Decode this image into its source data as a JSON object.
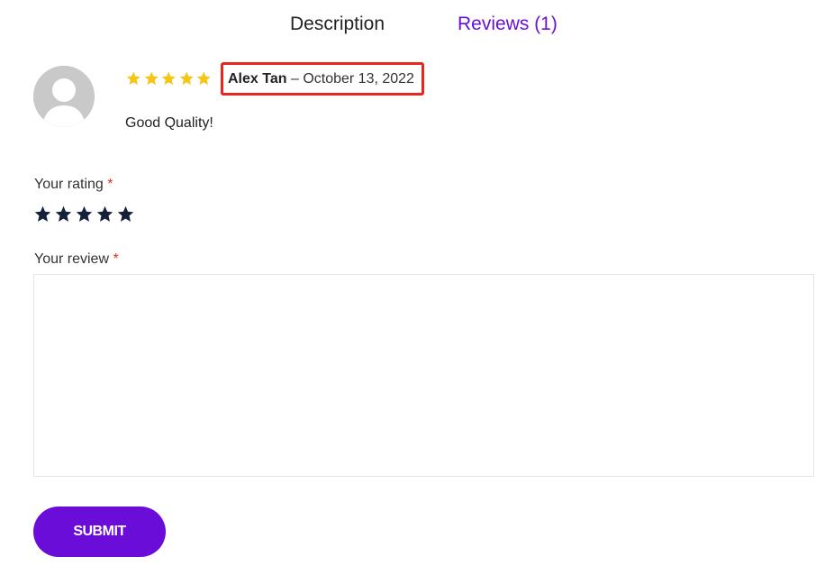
{
  "tabs": [
    {
      "label": "Description"
    },
    {
      "label": "Reviews (1)"
    }
  ],
  "colors": {
    "accent": "#6a0dd8",
    "star_filled": "#f5c518",
    "star_dark": "#14213a",
    "highlight_box": "#e8261f",
    "required": "#d9361a"
  },
  "review": {
    "avatar_icon": "user-avatar-icon",
    "rating_value": 5,
    "rating_max": 5,
    "author": "Alex Tan",
    "separator": "–",
    "date": "October 13, 2022",
    "text": "Good Quality!"
  },
  "form": {
    "rating_label": "Your rating",
    "required_mark": "*",
    "rating_star_count": 5,
    "review_label": "Your review",
    "review_value": "",
    "submit_label": "SUBMIT"
  }
}
